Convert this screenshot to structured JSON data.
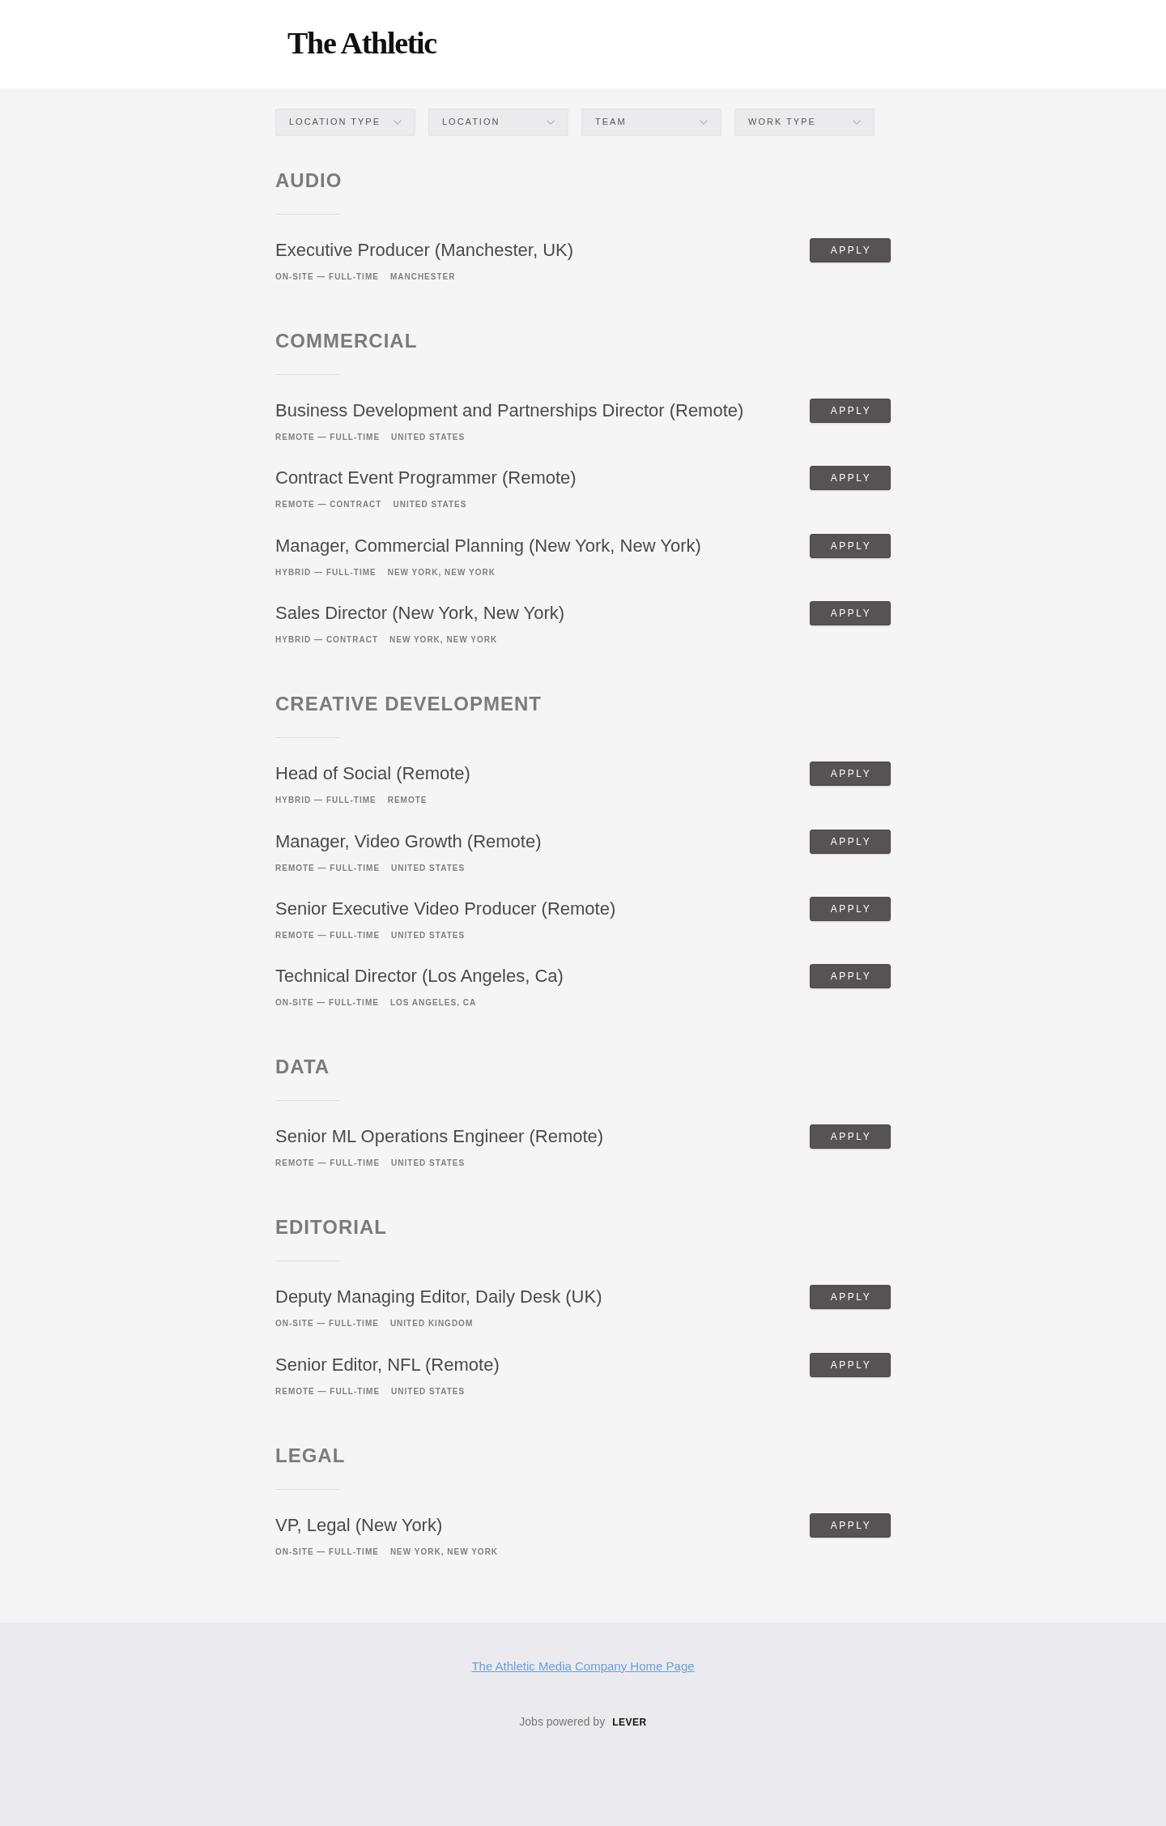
{
  "header": {
    "logo": "The Athletic"
  },
  "filters": [
    {
      "label": "LOCATION TYPE"
    },
    {
      "label": "LOCATION"
    },
    {
      "label": "TEAM"
    },
    {
      "label": "WORK TYPE"
    }
  ],
  "sections": [
    {
      "heading": "AUDIO",
      "postings": [
        {
          "title": "Executive Producer (Manchester, UK)",
          "commitment": "ON-SITE — FULL-TIME",
          "location": "MANCHESTER",
          "button": "APPLY"
        }
      ]
    },
    {
      "heading": "COMMERCIAL",
      "postings": [
        {
          "title": "Business Development and Partnerships Director (Remote)",
          "commitment": "REMOTE — FULL-TIME",
          "location": "UNITED STATES",
          "button": "APPLY"
        },
        {
          "title": "Contract Event Programmer (Remote)",
          "commitment": "REMOTE — CONTRACT",
          "location": "UNITED STATES",
          "button": "APPLY"
        },
        {
          "title": "Manager, Commercial Planning (New York, New York)",
          "commitment": "HYBRID — FULL-TIME",
          "location": "NEW YORK, NEW YORK",
          "button": "APPLY"
        },
        {
          "title": "Sales Director (New York, New York)",
          "commitment": "HYBRID — CONTRACT",
          "location": "NEW YORK, NEW YORK",
          "button": "APPLY"
        }
      ]
    },
    {
      "heading": "CREATIVE DEVELOPMENT",
      "postings": [
        {
          "title": "Head of Social (Remote)",
          "commitment": "HYBRID — FULL-TIME",
          "location": "REMOTE",
          "button": "APPLY"
        },
        {
          "title": "Manager, Video Growth (Remote)",
          "commitment": "REMOTE — FULL-TIME",
          "location": "UNITED STATES",
          "button": "APPLY"
        },
        {
          "title": "Senior Executive Video Producer (Remote)",
          "commitment": "REMOTE — FULL-TIME",
          "location": "UNITED STATES",
          "button": "APPLY"
        },
        {
          "title": "Technical Director (Los Angeles, Ca)",
          "commitment": "ON-SITE — FULL-TIME",
          "location": "LOS ANGELES, CA",
          "button": "APPLY"
        }
      ]
    },
    {
      "heading": "DATA",
      "postings": [
        {
          "title": "Senior ML Operations Engineer (Remote)",
          "commitment": "REMOTE — FULL-TIME",
          "location": "UNITED STATES",
          "button": "APPLY"
        }
      ]
    },
    {
      "heading": "EDITORIAL",
      "postings": [
        {
          "title": "Deputy Managing Editor, Daily Desk (UK)",
          "commitment": "ON-SITE — FULL-TIME",
          "location": "UNITED KINGDOM",
          "button": "APPLY"
        },
        {
          "title": "Senior Editor, NFL (Remote)",
          "commitment": "REMOTE — FULL-TIME",
          "location": "UNITED STATES",
          "button": "APPLY"
        }
      ]
    },
    {
      "heading": "LEGAL",
      "postings": [
        {
          "title": "VP, Legal (New York)",
          "commitment": "ON-SITE — FULL-TIME",
          "location": "NEW YORK, NEW YORK",
          "button": "APPLY"
        }
      ]
    }
  ],
  "footer": {
    "link": "The Athletic Media Company Home Page",
    "powered_by": "Jobs powered by",
    "brand": "LEVER"
  }
}
